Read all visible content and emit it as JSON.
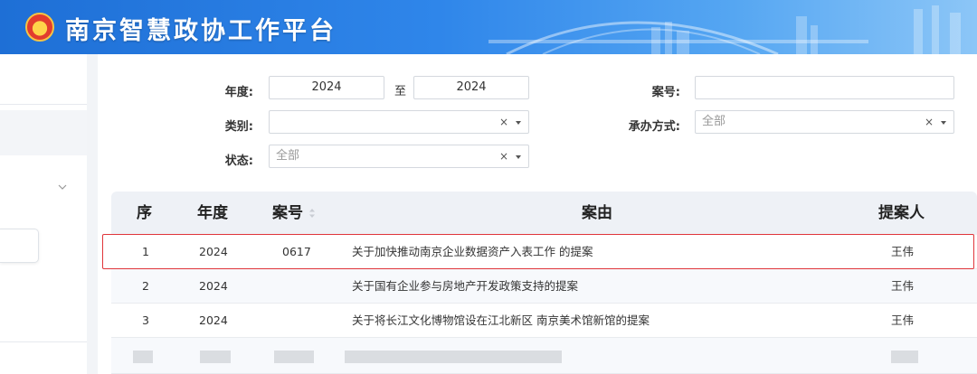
{
  "app": {
    "title": "南京智慧政协工作平台",
    "brand_color": "#1e6fd6",
    "logo_icon": "cppcc-emblem-icon"
  },
  "sidebar": {
    "expand_icon": "chevron-down-icon"
  },
  "filters": {
    "year_label": "年度:",
    "year_from": "2024",
    "to_label": "至",
    "year_to": "2024",
    "case_no_label": "案号:",
    "case_no_value": "",
    "category_label": "类别:",
    "category_value": "",
    "handling_label": "承办方式:",
    "handling_placeholder": "全部",
    "status_label": "状态:",
    "status_placeholder": "全部",
    "clear_glyph": "×"
  },
  "table": {
    "columns": [
      "序",
      "年度",
      "案号",
      "案由",
      "提案人"
    ],
    "rows": [
      {
        "seq": "1",
        "year": "2024",
        "case_no": "0617",
        "subject": "关于加快推动南京企业数据资产入表工作 的提案",
        "proposer": "王伟",
        "highlighted": true
      },
      {
        "seq": "2",
        "year": "2024",
        "case_no": "",
        "subject": "关于国有企业参与房地产开发政策支持的提案",
        "proposer": "王伟"
      },
      {
        "seq": "3",
        "year": "2024",
        "case_no": "",
        "subject": "关于将长江文化博物馆设在江北新区 南京美术馆新馆的提案",
        "proposer": "王伟"
      }
    ],
    "highlight_color": "#e0353a"
  }
}
